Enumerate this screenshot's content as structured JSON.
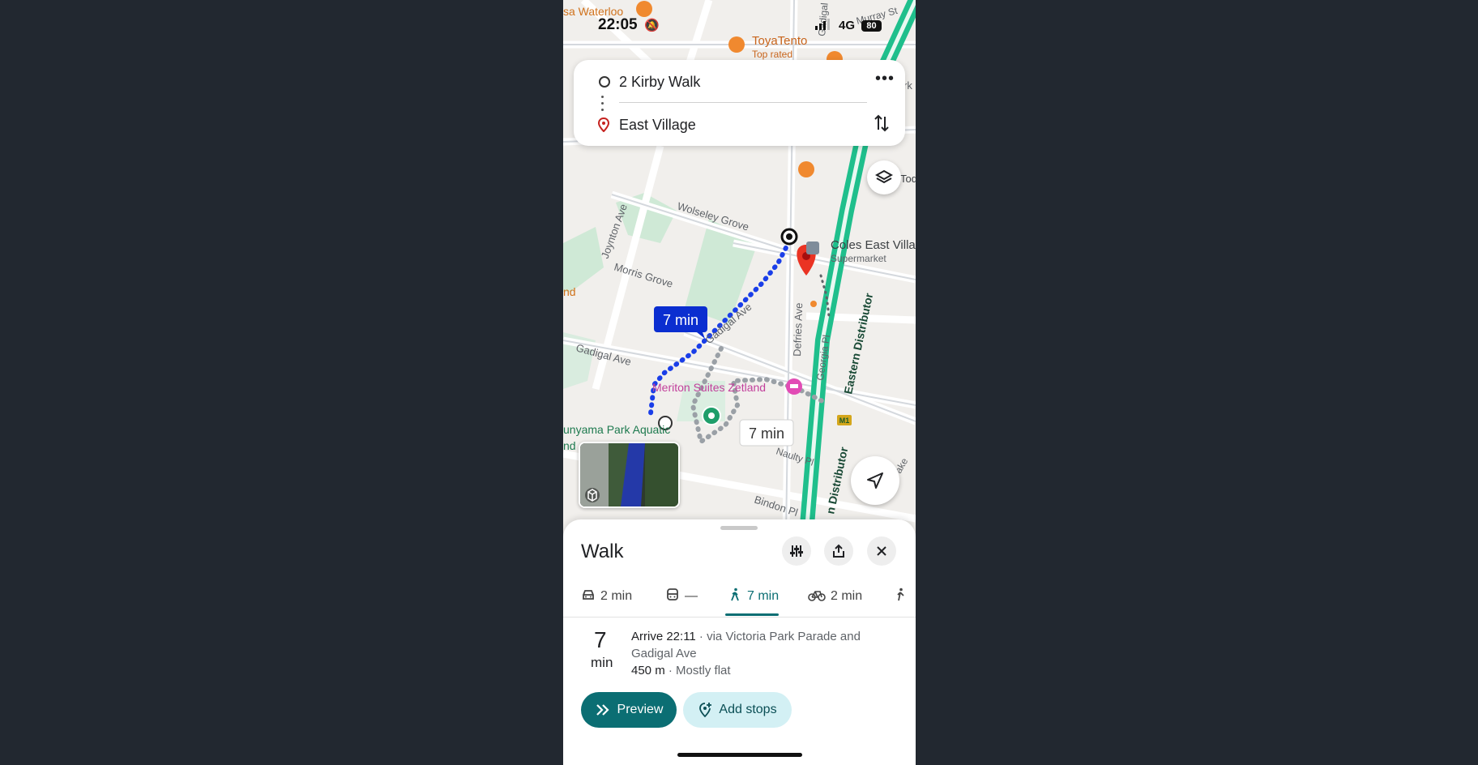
{
  "status_bar": {
    "time": "22:05",
    "network": "4G",
    "battery": "80"
  },
  "route": {
    "origin": "2 Kirby Walk",
    "destination": "East Village"
  },
  "map": {
    "labels": {
      "waterloo": "sa Waterloo",
      "toyatento": "ToyaTento",
      "top_rated": "Top rated",
      "gadigal_top": "Gadigal",
      "murray_st": "Murray St",
      "wolseley_grove": "Wolseley Grove",
      "joynton_ave": "Joynton Ave",
      "morris_grove": "Morris Grove",
      "gadigal_ave_diag": "Gadigal Ave",
      "gadigal_ave_left": "Gadigal Ave",
      "defries_ave": "Defries Ave",
      "georgia_pl": "Georgia Pl",
      "eastern_distributor": "Eastern Distributor",
      "distributor_lower": "n Distributor",
      "coles": "Coles East Villa",
      "supermarket": "Supermarket",
      "meriton": "Meriton Suites Zetland",
      "aquatic": "unyama Park Aquatic",
      "aquatic_2": "nd",
      "left_edge": "nd",
      "bindon_pl": "Bindon Pl",
      "naulty_pl": "Naulty Pl",
      "m1": "M1",
      "right_edge_1": "rk",
      "right_edge_2": "Tod",
      "right_edge_3": "ake"
    },
    "route_time_badge": "7 min",
    "alt_time_badge": "7 min",
    "colors": {
      "route": "#1a3ee8",
      "distributor": "#1fbf8c",
      "park": "#a5dcb6",
      "badge": "#0b2ed0"
    }
  },
  "sheet": {
    "title": "Walk",
    "modes": [
      {
        "icon": "car-icon",
        "label": "2 min"
      },
      {
        "icon": "transit-icon",
        "label": "—"
      },
      {
        "icon": "walk-icon",
        "label": "7 min",
        "active": true
      },
      {
        "icon": "bike-icon",
        "label": "2 min"
      },
      {
        "icon": "rideshare-icon",
        "label": ""
      }
    ],
    "summary": {
      "duration_value": "7",
      "duration_unit": "min",
      "arrive": "Arrive 22:11",
      "via": " · via Victoria Park Parade and Gadigal Ave",
      "distance": "450 m",
      "terrain": " · Mostly flat"
    },
    "buttons": {
      "preview": "Preview",
      "add_stops": "Add stops"
    }
  }
}
